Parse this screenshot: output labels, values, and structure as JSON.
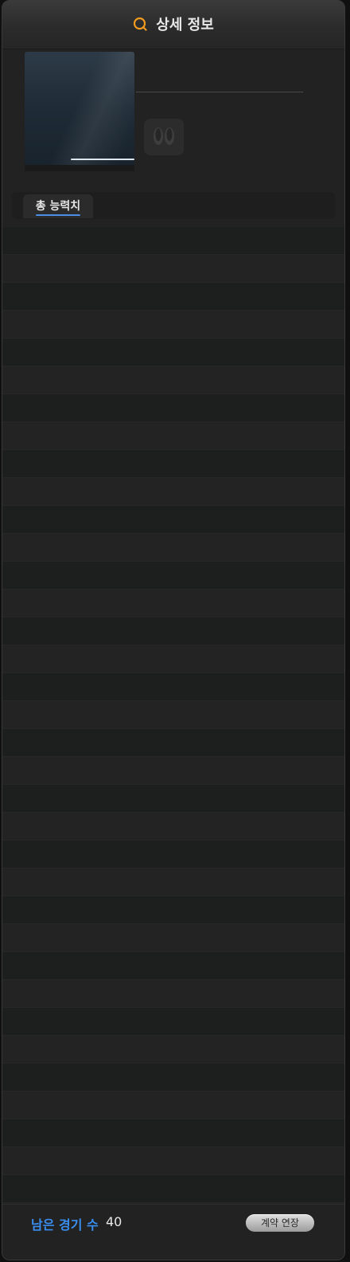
{
  "header": {
    "title": "상세 정보",
    "icon": "search-icon",
    "icon_color": "#f39c1e"
  },
  "tabs": [
    {
      "label": "총 능력치",
      "active": true
    }
  ],
  "accent_color": "#3a8ef0",
  "footer": {
    "games_label": "남은 경기 수",
    "games_count": "40",
    "renew_button_label": "계약 연장"
  }
}
